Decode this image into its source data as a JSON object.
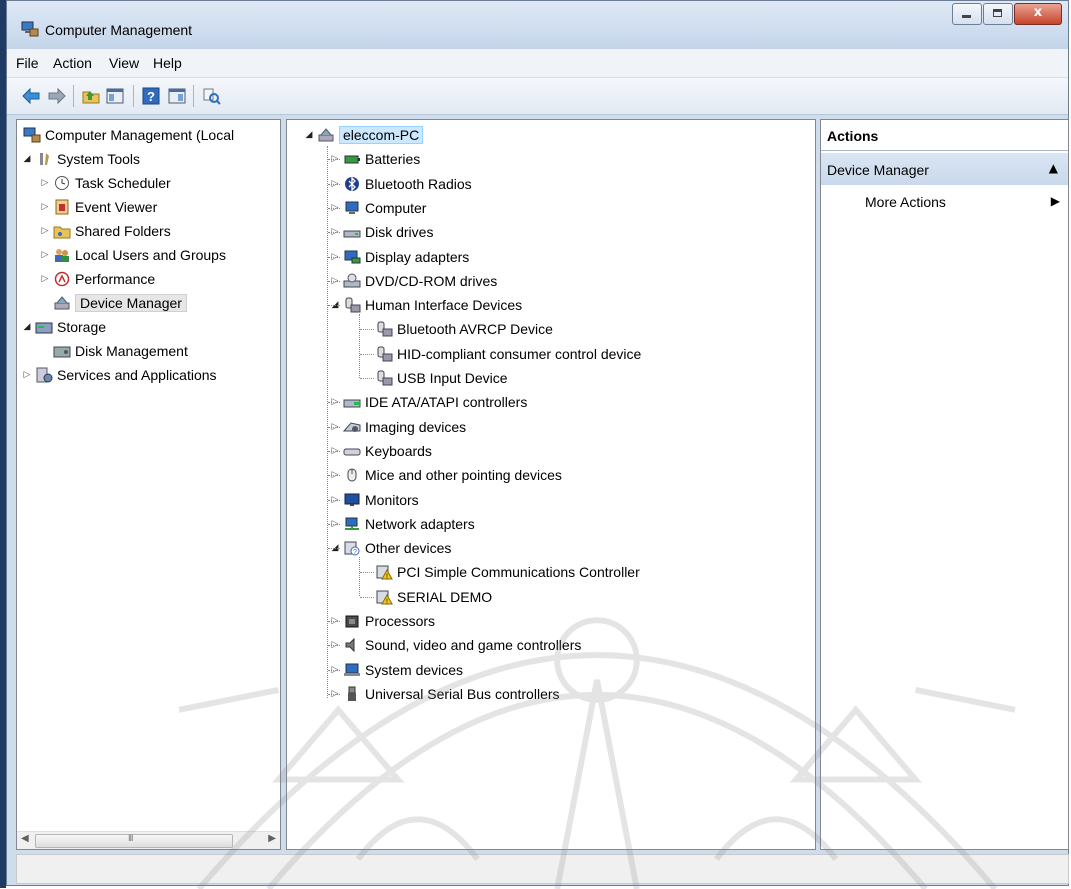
{
  "window": {
    "title": "Computer Management",
    "buttons": {
      "minimize": "minimize",
      "maximize": "maximize",
      "close": "x"
    }
  },
  "menu": [
    "File",
    "Action",
    "View",
    "Help"
  ],
  "toolbar_icons": [
    "back-arrow-icon",
    "forward-arrow-icon",
    "up-folder-icon",
    "show-hide-console-tree-icon",
    "help-icon",
    "show-hide-action-pane-icon",
    "properties-icon"
  ],
  "left_tree": {
    "root": "Computer Management (Local",
    "system_tools": "System Tools",
    "task_scheduler": "Task Scheduler",
    "event_viewer": "Event Viewer",
    "shared_folders": "Shared Folders",
    "local_users": "Local Users and Groups",
    "performance": "Performance",
    "device_manager": "Device Manager",
    "storage": "Storage",
    "disk_management": "Disk Management",
    "services": "Services and Applications"
  },
  "device_tree": {
    "computer": "eleccom-PC",
    "categories": [
      {
        "label": "Batteries",
        "expanded": false,
        "icon": "battery-icon"
      },
      {
        "label": "Bluetooth Radios",
        "expanded": false,
        "icon": "bluetooth-icon"
      },
      {
        "label": "Computer",
        "expanded": false,
        "icon": "computer-icon"
      },
      {
        "label": "Disk drives",
        "expanded": false,
        "icon": "disk-drive-icon"
      },
      {
        "label": "Display adapters",
        "expanded": false,
        "icon": "display-adapter-icon"
      },
      {
        "label": "DVD/CD-ROM drives",
        "expanded": false,
        "icon": "dvd-drive-icon"
      },
      {
        "label": "Human Interface Devices",
        "expanded": true,
        "icon": "hid-icon",
        "children": [
          "Bluetooth AVRCP Device",
          "HID-compliant consumer control device",
          "USB Input Device"
        ]
      },
      {
        "label": "IDE ATA/ATAPI controllers",
        "expanded": false,
        "icon": "ide-controller-icon"
      },
      {
        "label": "Imaging devices",
        "expanded": false,
        "icon": "imaging-device-icon"
      },
      {
        "label": "Keyboards",
        "expanded": false,
        "icon": "keyboard-icon"
      },
      {
        "label": "Mice and other pointing devices",
        "expanded": false,
        "icon": "mouse-icon"
      },
      {
        "label": "Monitors",
        "expanded": false,
        "icon": "monitor-icon"
      },
      {
        "label": "Network adapters",
        "expanded": false,
        "icon": "network-adapter-icon"
      },
      {
        "label": "Other devices",
        "expanded": true,
        "icon": "other-devices-icon",
        "children": [
          "PCI Simple Communications Controller",
          "SERIAL DEMO"
        ]
      },
      {
        "label": "Processors",
        "expanded": false,
        "icon": "processor-icon"
      },
      {
        "label": "Sound, video and game controllers",
        "expanded": false,
        "icon": "sound-icon"
      },
      {
        "label": "System devices",
        "expanded": false,
        "icon": "system-devices-icon"
      },
      {
        "label": "Universal Serial Bus controllers",
        "expanded": false,
        "icon": "usb-icon"
      }
    ]
  },
  "actions": {
    "header": "Actions",
    "section": "Device Manager",
    "item": "More Actions"
  },
  "scrollbar": {
    "grip": "III"
  },
  "colors": {
    "titlebar": "#c4d5ea",
    "selection": "#cce8ff",
    "actions_section": "#c9d8ec",
    "close_button": "#c7442c"
  }
}
